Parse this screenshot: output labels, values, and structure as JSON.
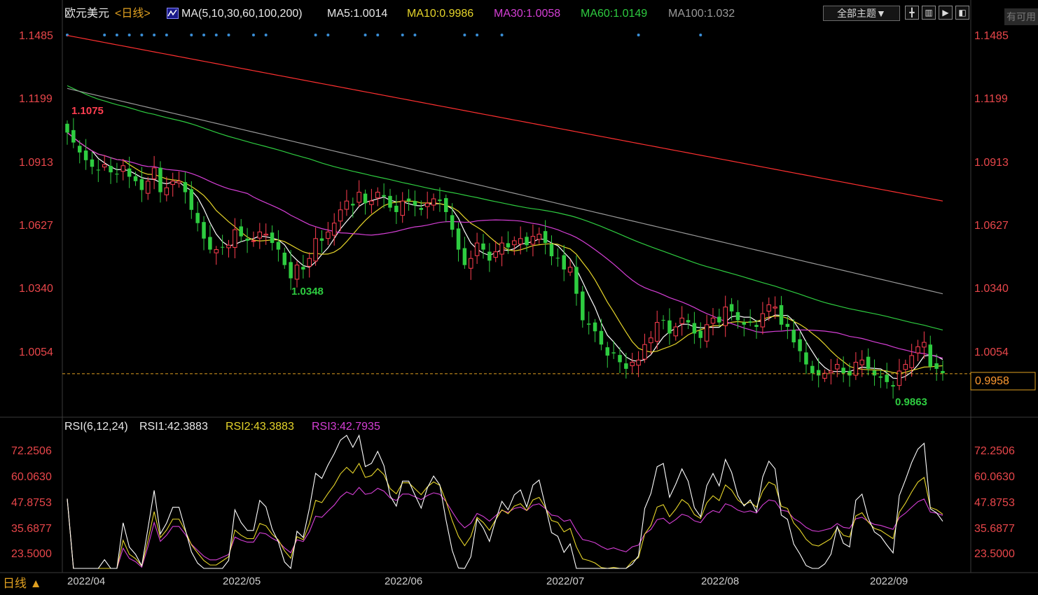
{
  "header": {
    "symbol": "欧元美元",
    "period": "<日线>",
    "ma_label": "MA(5,10,30,60,100,200)",
    "ma5": "MA5:1.0014",
    "ma10": "MA10:0.9986",
    "ma30": "MA30:1.0058",
    "ma60": "MA60:1.0149",
    "ma100": "MA100:1.032",
    "theme_button": "全部主题▼",
    "corner_text": "有可用"
  },
  "rsi_header": {
    "label": "RSI(6,12,24)",
    "rsi1": "RSI1:42.3883",
    "rsi2": "RSI2:43.3883",
    "rsi3": "RSI3:42.7935"
  },
  "footer": {
    "period_label": "日线 ▲"
  },
  "colors": {
    "up": "#ff3e50",
    "down": "#2ecc40",
    "ma5": "#ffffff",
    "ma10": "#e6d52a",
    "ma30": "#d63fd6",
    "ma60": "#2ecc40",
    "ma100": "#9a9a9a",
    "ma200": "#ff3030",
    "axis_text": "#e8464a",
    "current_line": "#e0a020"
  },
  "chart_data": {
    "type": "candlestick",
    "price_axis": {
      "ticks": [
        "1.1485",
        "1.1199",
        "1.0913",
        "1.0627",
        "1.0340",
        "1.0054"
      ],
      "range": [
        0.978,
        1.153
      ]
    },
    "current_price": "0.9958",
    "high_marker": "1.1075",
    "low_marker_1": "1.0348",
    "low_marker_2": "0.9863",
    "x_labels": [
      "2022/04",
      "2022/05",
      "2022/06",
      "2022/07",
      "2022/08",
      "2022/09"
    ],
    "closes": [
      1.105,
      1.1005,
      1.096,
      1.0925,
      1.0895,
      1.088,
      1.0905,
      1.087,
      1.086,
      1.09,
      1.085,
      1.083,
      1.079,
      1.083,
      1.089,
      1.078,
      1.08,
      1.083,
      1.083,
      1.078,
      1.07,
      1.064,
      1.057,
      1.052,
      1.052,
      1.053,
      1.054,
      1.061,
      1.058,
      1.056,
      1.056,
      1.06,
      1.059,
      1.055,
      1.052,
      1.045,
      1.039,
      1.045,
      1.043,
      1.048,
      1.057,
      1.056,
      1.06,
      1.064,
      1.07,
      1.074,
      1.072,
      1.078,
      1.073,
      1.074,
      1.078,
      1.076,
      1.071,
      1.069,
      1.074,
      1.074,
      1.072,
      1.07,
      1.073,
      1.075,
      1.074,
      1.069,
      1.061,
      1.052,
      1.045,
      1.048,
      1.055,
      1.052,
      1.047,
      1.051,
      1.055,
      1.053,
      1.056,
      1.057,
      1.054,
      1.058,
      1.059,
      1.055,
      1.049,
      1.048,
      1.043,
      1.044,
      1.032,
      1.02,
      1.018,
      1.015,
      1.009,
      1.004,
      1.005,
      1.001,
      0.998,
      1.001,
      1.002,
      1.009,
      1.012,
      1.019,
      1.02,
      1.014,
      1.017,
      1.021,
      1.019,
      1.014,
      1.012,
      1.018,
      1.021,
      1.019,
      1.026,
      1.024,
      1.02,
      1.018,
      1.019,
      1.017,
      1.023,
      1.027,
      1.026,
      1.018,
      1.017,
      1.01,
      1.006,
      1.0,
      0.996,
      0.995,
      0.996,
      0.997,
      1.0,
      0.996,
      0.995,
      1.001,
      1.002,
      0.998,
      0.995,
      0.994,
      0.992,
      0.99,
      0.997,
      1.0,
      1.004,
      1.008,
      1.01,
      0.999,
      0.998,
      0.996
    ],
    "ma_current": {
      "MA5": 1.0014,
      "MA10": 0.9986,
      "MA30": 1.0058,
      "MA60": 1.0149,
      "MA100": 1.032
    },
    "rsi": {
      "ticks": [
        "72.2506",
        "60.0630",
        "47.8753",
        "35.6877",
        "23.5000"
      ],
      "range": [
        17,
        80
      ],
      "current": {
        "RSI1": 42.3883,
        "RSI2": 43.3883,
        "RSI3": 42.7935
      }
    }
  }
}
